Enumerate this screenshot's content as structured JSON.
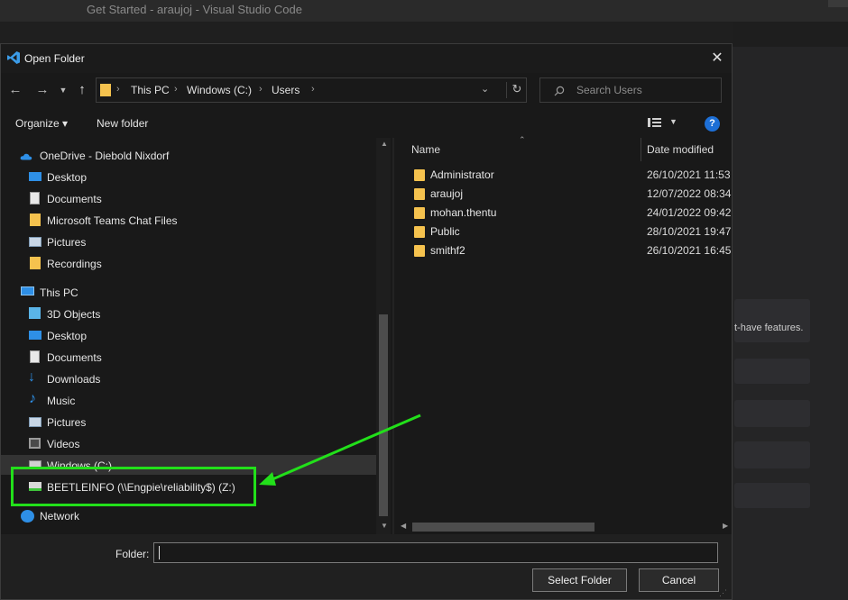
{
  "background": {
    "window_title": "Get Started - araujoj - Visual Studio Code",
    "partial_text": "t-have features."
  },
  "dialog": {
    "title": "Open Folder",
    "close_glyph": "✕",
    "breadcrumb": [
      "This PC",
      "Windows (C:)",
      "Users"
    ],
    "search_placeholder": "Search Users",
    "toolbar": {
      "organize": "Organize ▾",
      "new_folder": "New folder",
      "help": "?"
    },
    "nav": {
      "onedrive": "OneDrive - Diebold Nixdorf",
      "onedrive_items": [
        "Desktop",
        "Documents",
        "Microsoft Teams Chat Files",
        "Pictures",
        "Recordings"
      ],
      "this_pc": "This PC",
      "pc_items": [
        "3D Objects",
        "Desktop",
        "Documents",
        "Downloads",
        "Music",
        "Pictures",
        "Videos",
        "Windows (C:)"
      ],
      "network_drive": "BEETLEINFO (\\\\Engpie\\reliability$) (Z:)",
      "network": "Network"
    },
    "list": {
      "col_name": "Name",
      "col_date": "Date modified",
      "rows": [
        {
          "name": "Administrator",
          "date": "26/10/2021 11:53"
        },
        {
          "name": "araujoj",
          "date": "12/07/2022 08:34"
        },
        {
          "name": "mohan.thentu",
          "date": "24/01/2022 09:42"
        },
        {
          "name": "Public",
          "date": "28/10/2021 19:47"
        },
        {
          "name": "smithf2",
          "date": "26/10/2021 16:45"
        }
      ]
    },
    "folder_label": "Folder:",
    "folder_value": "",
    "select_button": "Select Folder",
    "cancel_button": "Cancel"
  },
  "colors": {
    "annotation": "#22e01a",
    "folder_icon": "#f5c24e",
    "help_icon": "#1d6fd6"
  }
}
